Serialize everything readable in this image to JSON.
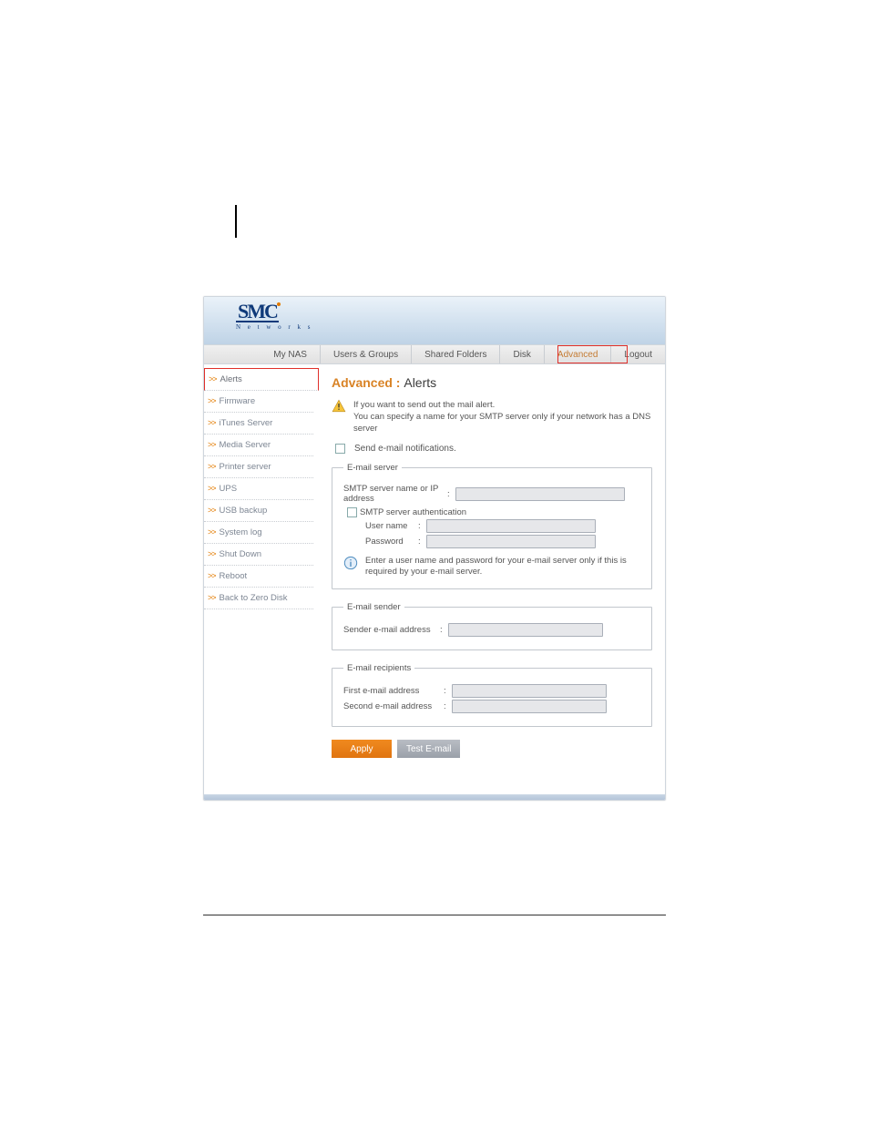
{
  "logo": {
    "main": "SMC",
    "sub": "N e t w o r k s"
  },
  "nav": {
    "items": [
      {
        "label": "My NAS"
      },
      {
        "label": "Users & Groups"
      },
      {
        "label": "Shared Folders"
      },
      {
        "label": "Disk"
      },
      {
        "label": "Advanced"
      },
      {
        "label": "Logout"
      }
    ]
  },
  "sidebar": {
    "items": [
      {
        "label": "Alerts",
        "active": true
      },
      {
        "label": "Firmware"
      },
      {
        "label": "iTunes Server"
      },
      {
        "label": "Media Server"
      },
      {
        "label": "Printer server"
      },
      {
        "label": "UPS"
      },
      {
        "label": "USB backup"
      },
      {
        "label": "System log"
      },
      {
        "label": "Shut Down"
      },
      {
        "label": "Reboot"
      },
      {
        "label": "Back to Zero Disk"
      }
    ]
  },
  "content": {
    "title_pre": "Advanced : ",
    "title_post": "Alerts",
    "warn_line1": "If you want to send out the mail alert.",
    "warn_line2": "You can specify a name for your SMTP server only if your network has a DNS server",
    "notify_label": "Send e-mail notifications.",
    "fs_server": {
      "legend": "E-mail server",
      "smtp_label": "SMTP server name or IP address",
      "auth_label": "SMTP server authentication",
      "user_label": "User name",
      "pass_label": "Password",
      "info_text": "Enter a user name and password for your e-mail server only if this is required by your e-mail server."
    },
    "fs_sender": {
      "legend": "E-mail sender",
      "sender_label": "Sender e-mail address"
    },
    "fs_recipients": {
      "legend": "E-mail recipients",
      "first_label": "First e-mail address",
      "second_label": "Second e-mail address"
    },
    "buttons": {
      "apply": "Apply",
      "test": "Test E-mail"
    }
  }
}
